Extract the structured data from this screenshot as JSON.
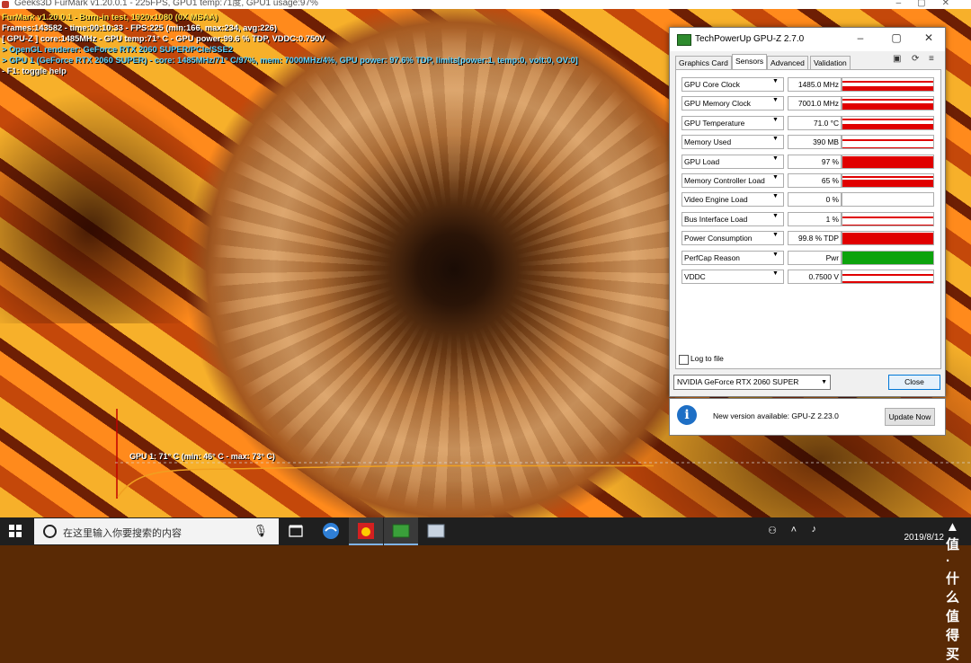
{
  "window": {
    "title": "Geeks3D FurMark v1.20.0.1 - 225FPS, GPU1 temp:71度, GPU1 usage:97%"
  },
  "osd": {
    "lines": [
      "FurMark v1.20.0.1 - Burn-in test, 1920x1080 (0X MSAA)",
      "Frames:143582 - time:00:10:33 - FPS:225 (min:166, max:234, avg:226)",
      "[ GPU-Z ] core:1485MHz - GPU temp:71° C - GPU power:99.6 % TDP, VDDC:0.750V",
      "> OpenGL renderer: GeForce RTX 2060 SUPER/PCIe/SSE2",
      "> GPU 1 (GeForce RTX 2060 SUPER) - core: 1485MHz/71° C/97%, mem: 7000MHz/4%, GPU power: 97.6% TDP, limits[power:1, temp:0, volt:0, OV:0]",
      "- F1: toggle help"
    ]
  },
  "temp_graph": {
    "label": "GPU 1: 71° C (min: 46° C - max: 73° C)",
    "min": 46,
    "max": 73,
    "current": 71,
    "color": "#f0a020"
  },
  "gpuz": {
    "title": "TechPowerUp GPU-Z 2.7.0",
    "tabs": [
      "Graphics Card",
      "Sensors",
      "Advanced",
      "Validation"
    ],
    "active_tab": "Sensors",
    "sensors": [
      {
        "name": "GPU Core Clock",
        "value": "1485.0 MHz",
        "level": 0.35,
        "color": "#e00000"
      },
      {
        "name": "GPU Memory Clock",
        "value": "7001.0 MHz",
        "level": 0.55,
        "color": "#e00000"
      },
      {
        "name": "GPU Temperature",
        "value": "71.0 °C",
        "level": 0.45,
        "color": "#e00000"
      },
      {
        "name": "Memory Used",
        "value": "390 MB",
        "level": 0.1,
        "color": "#e00000"
      },
      {
        "name": "GPU Load",
        "value": "97 %",
        "level": 0.8,
        "color": "#e00000"
      },
      {
        "name": "Memory Controller Load",
        "value": "65 %",
        "level": 0.55,
        "color": "#e00000"
      },
      {
        "name": "Video Engine Load",
        "value": "0 %",
        "level": 0,
        "color": "#e00000"
      },
      {
        "name": "Bus Interface Load",
        "value": "1 %",
        "level": 0.05,
        "color": "#e00000"
      },
      {
        "name": "Power Consumption",
        "value": "99.8 % TDP",
        "level": 0.85,
        "color": "#e00000"
      },
      {
        "name": "PerfCap Reason",
        "value": "Pwr",
        "level": 1,
        "color": "#0ca30c"
      },
      {
        "name": "VDDC",
        "value": "0.7500 V",
        "level": 0.15,
        "color": "#e00000"
      }
    ],
    "log_to_file": "Log to file",
    "device": "NVIDIA GeForce RTX 2060 SUPER",
    "close_label": "Close"
  },
  "update": {
    "message": "New version available: GPU-Z 2.23.0",
    "button": "Update Now"
  },
  "taskbar": {
    "search_placeholder": "在这里输入你要搜索的内容",
    "clock_date": "2019/8/12"
  }
}
